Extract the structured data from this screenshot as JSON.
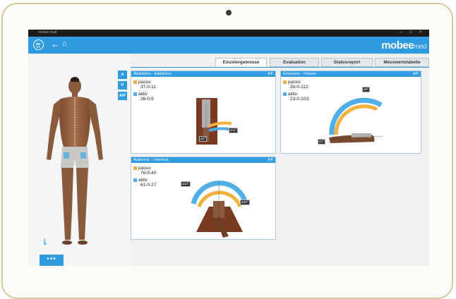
{
  "window": {
    "app_name": "mobee med"
  },
  "header": {
    "logo_main": "mobee",
    "logo_suffix": "med"
  },
  "tabs": [
    {
      "label": "Einzelergebnisse",
      "active": true
    },
    {
      "label": "Evaluation",
      "active": false
    },
    {
      "label": "Statusreport",
      "active": false
    },
    {
      "label": "Messwertetabelle",
      "active": false
    }
  ],
  "perspective_buttons": [
    "A",
    "P",
    "A/P"
  ],
  "cards": {
    "abduction": {
      "title": "Abduktion - Adduktion",
      "suffix": "A/P",
      "passive_label": "passiv",
      "passive_value": "37-0-11",
      "active_label": "aktiv",
      "active_value": "26-0-9",
      "deltas": [
        "Δ11°",
        "Δ2°"
      ]
    },
    "extension": {
      "title": "Extension - Flexion",
      "suffix": "A/P",
      "passive_label": "passiv",
      "passive_value": "30-0-112",
      "active_label": "aktiv",
      "active_value": "23-0-103",
      "deltas": [
        "Δ9°",
        "Δ7°"
      ]
    },
    "rotation": {
      "title": "Außenrot. - Innenrot.",
      "suffix": "A/P",
      "passive_label": "passiv",
      "passive_value": "76-0-40",
      "active_label": "aktiv",
      "active_value": "61-0-27",
      "deltas": [
        "Δ13°",
        "Δ15°"
      ]
    }
  },
  "bottom_menu_label": "•••",
  "colors": {
    "accent": "#2f9be0",
    "passive": "#f4b03c",
    "active": "#4faee6"
  }
}
